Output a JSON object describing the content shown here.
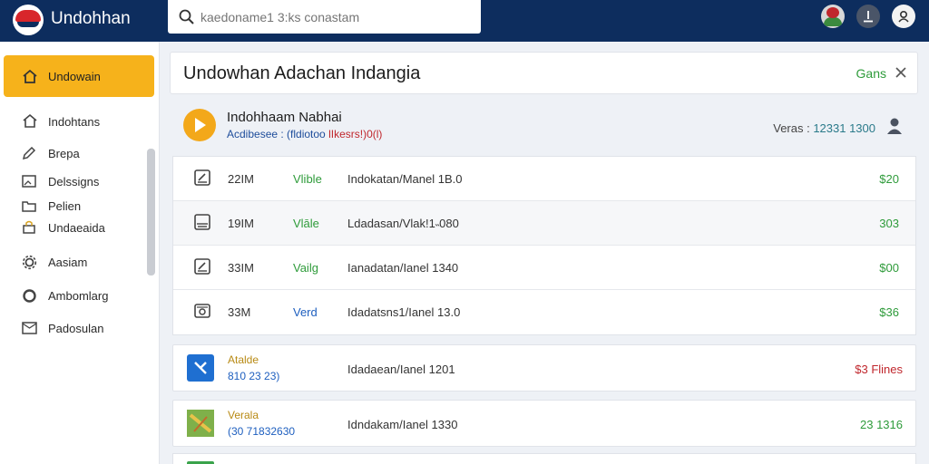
{
  "app": {
    "title": "Undohhan"
  },
  "search": {
    "placeholder": "kaedoname1 3:ks conastam"
  },
  "topbar": {
    "icons": [
      "avatar-icon",
      "upload-icon",
      "profile-icon"
    ]
  },
  "sidebar": {
    "items": [
      {
        "label": "Undowain",
        "icon": "home-icon",
        "active": true
      },
      {
        "label": "Indohtans",
        "icon": "home-icon"
      },
      {
        "label": "Brepa",
        "icon": "pencil-icon"
      },
      {
        "label": "Delssigns",
        "icon": "image-icon"
      },
      {
        "label": "Pelien",
        "icon": "folder-icon"
      },
      {
        "label": "Undaeaida",
        "icon": "lock-icon"
      },
      {
        "label": "Aasiam",
        "icon": "gear-icon"
      },
      {
        "label": "Ambomlarg",
        "icon": "circle-icon"
      },
      {
        "label": "Padosulan",
        "icon": "mail-icon"
      }
    ]
  },
  "header": {
    "title": "Undowhan Adachan Indangia",
    "action": "Gans"
  },
  "summary": {
    "title": "Indohhaam Nabhai",
    "subtitle_a": "Acdibesee : (fldiotoo",
    "subtitle_b": "lIkesrs!)0(l)",
    "right_label": "Veras : ",
    "right_value": "12331 1300"
  },
  "rows": [
    {
      "size": "22IM",
      "tag": "Vlible",
      "desc": "Indokatan/Manel 1B.0",
      "price": "$20",
      "icon": "edit-icon"
    },
    {
      "size": "19IM",
      "tag": "Vlāle",
      "desc": "Ldadasan/Vlak!1˵080",
      "price": "303",
      "icon": "inbox-icon"
    },
    {
      "size": "33IM",
      "tag": "Vailg",
      "desc": "Ianadatan/Ianel 1340",
      "price": "$00",
      "icon": "edit-icon"
    },
    {
      "size": "33M",
      "tag": "Verd",
      "desc": "Idadatsns1/Ianel 13.0",
      "price": "$36",
      "icon": "camera-icon"
    }
  ],
  "cards": [
    {
      "title": "Atalde",
      "sub": "810 23 23)",
      "desc": "Idadaean/Ianel 1201",
      "right": "$3 Flines",
      "tile_color": "#1f6fd1"
    },
    {
      "title": "Verala",
      "sub": "(30 71832630",
      "desc": "Idndakam/Ianel 1330",
      "right": "23 1316",
      "tile_color": "#6a9a3a"
    }
  ]
}
